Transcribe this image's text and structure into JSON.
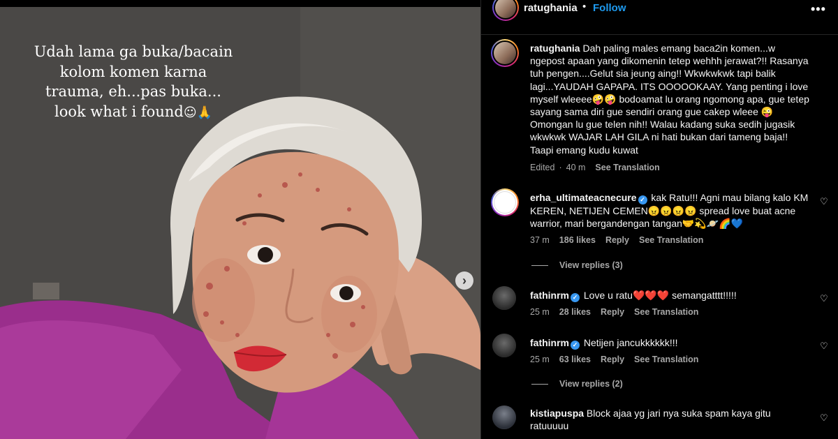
{
  "post": {
    "caption": "Udah lama ga buka/bacain\nkolom komen karna\ntrauma, eh...pas buka...\nlook what i found",
    "caption_emoji": "☺🙏"
  },
  "header": {
    "username": "ratughania",
    "separator": "•",
    "follow_label": "Follow",
    "more_icon": "more-horizontal-icon",
    "more_glyph": "•••"
  },
  "caption_comment": {
    "username": "ratughania",
    "text": "Dah paling males emang baca2in komen...w ngepost apaan yang dikomenin tetep wehhh jerawat?!! Rasanya tuh pengen....Gelut sia jeung aing!! Wkwkwkwk tapi balik lagi...YAUDAH GAPAPA. ITS OOOOOKAAY. Yang penting i love myself wleeee🤪🤪 bodoamat lu orang ngomong apa, gue tetep sayang sama diri gue sendiri orang gue cakep wleee 😜 Omongan lu gue telen nih!! Walau kadang suka sedih jugasik wkwkwk WAJAR LAH GILA ni hati bukan dari tameng baja!! Taapi emang kudu kuwat",
    "edited": "Edited",
    "time": "40 m",
    "see_translation": "See Translation"
  },
  "comments": [
    {
      "username": "erha_ultimateacnecure",
      "verified": true,
      "text": "kak Ratu!!! Agni mau bilang kalo KM KEREN, NETIJEN CEMEN😠😠😠😠 spread love buat acne warrior, mari bergandengan tangan🤝💫🪐🌈💙",
      "time": "37 m",
      "likes": "186 likes",
      "reply": "Reply",
      "see_translation": "See Translation",
      "view_replies": "View replies (3)"
    },
    {
      "username": "fathinrm",
      "verified": true,
      "text": "Love u ratu❤️❤️❤️ semangatttt!!!!!",
      "time": "25 m",
      "likes": "28 likes",
      "reply": "Reply",
      "see_translation": "See Translation"
    },
    {
      "username": "fathinrm",
      "verified": true,
      "text": "Netijen jancukkkkkk!!!",
      "time": "25 m",
      "likes": "63 likes",
      "reply": "Reply",
      "see_translation": "See Translation",
      "view_replies": "View replies (2)"
    },
    {
      "username": "kistiapuspa",
      "verified": false,
      "text": "Block ajaa yg jari nya suka spam kaya gitu ratuuuuu"
    }
  ],
  "icons": {
    "heart": "♡",
    "carousel_next": "›",
    "verified": "✓"
  },
  "colors": {
    "follow": "#1e9bf0",
    "verified": "#3897f0",
    "muted": "#a8a8a8"
  }
}
